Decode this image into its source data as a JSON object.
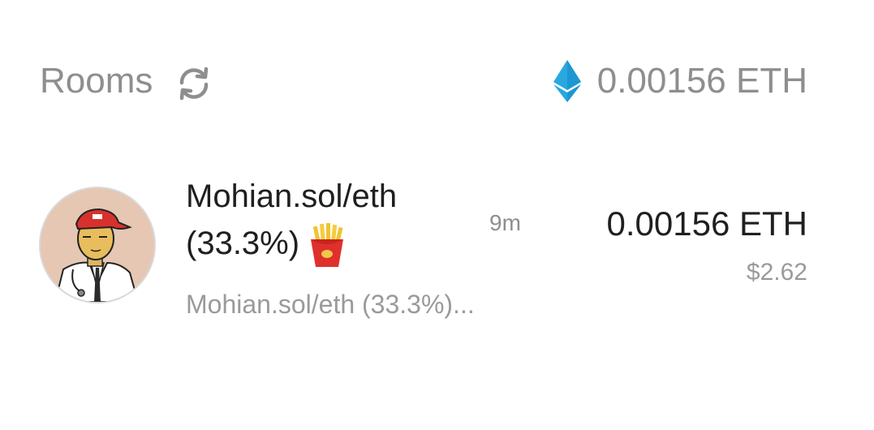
{
  "header": {
    "title": "Rooms",
    "refresh_icon": "refresh-icon",
    "balance_icon": "ethereum-icon",
    "balance": "0.00156 ETH",
    "eth_color": "#29a8e0"
  },
  "rooms": [
    {
      "name_line1": "Mohian.sol/eth",
      "name_line2": "(33.3%)",
      "emoji_icon": "french-fries-icon",
      "preview": "Mohian.sol/eth (33.3%)...",
      "time": "9m",
      "amount": "0.00156 ETH",
      "usd": "$2.62",
      "avatar_icon": "doctor-avatar-icon"
    }
  ]
}
